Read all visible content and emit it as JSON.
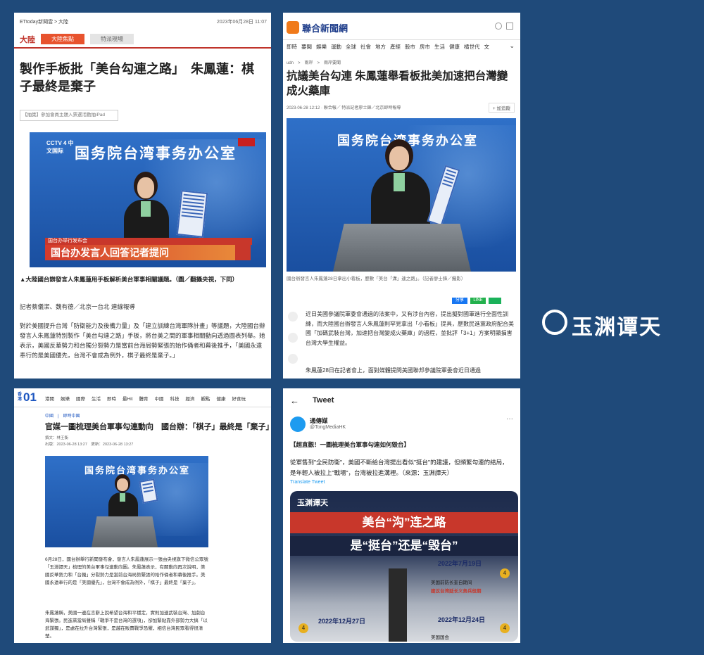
{
  "p1": {
    "source": "ETtoday新聞雲 > 大陸",
    "datetime": "2023年06月28日 11:07",
    "section": "大陸",
    "tab_active": "大陸焦點",
    "tab_other": "特派現場",
    "headline": "製作手板批「美台勾連之路」　朱鳳蓮：棋子最終是棄子",
    "promo": "【抽獎】參加會員主題入票選活動抽iPad",
    "tv_logo": "CCTV 4 中文国际",
    "sign": "国务院台湾事务办公室",
    "banner_top": "国台办举行发布会",
    "banner": "国台办发言人回答记者提问",
    "caption": "▲大陸國台辦發言人朱鳳蓮用手板解析美台軍事相關議題。（圖／翻攝央視，下同）",
    "byline": "記者蔡儀潔、魏有德／北京一台北 連線報導",
    "body": "對於美國提升台灣「防衛能力及後備力量」及「建立訓練台灣軍隊計畫」等議題，大陸國台辦發言人朱鳳蓮特別製作「美台勾連之路」手板，將台美之間的軍事相關動向透過圖表列舉。她表示，美國反華勢力和台獨分裂勢力是當前台海局勢緊張的始作俑者和幕後推手，「美國永遠奉行的是美國優先，台灣不會成為例外，棋子最終是棄子。」"
  },
  "p2": {
    "brand": "聯合新聞網",
    "nav": [
      "即時",
      "要聞",
      "娛樂",
      "運動",
      "全球",
      "社會",
      "地方",
      "產經",
      "股市",
      "房市",
      "生活",
      "健康",
      "橘世代",
      "文"
    ],
    "breadcrumb": "udn　>　兩岸　>　兩岸要聞",
    "headline": "抗議美台勾連 朱鳳蓮舉看板批美加速把台灣變成火藥庫",
    "meta": "2023-06-28 12:12 · 聯合報／ 特派記者廖士鋒／北京即時報導",
    "follow": "+ 加追蹤",
    "sign": "国务院台湾事务办公室",
    "caption": "國台辦發言人朱鳳蓮28日拿出小看板，歷數「美台「溝」連之路」。（記者廖士鋒／攝影）",
    "share1": "分享",
    "share2": "LINE",
    "body1": "近日美國參議院軍委會通過的法案中，又有涉台內容，提出擬對國軍進行全面性訓練，而大陸國台辦發言人朱鳳蓮則罕見拿出「小看板」提具，歷數民進黨政府配合美國「加碼武裝台灣，加速把台灣變成火藥庫」的過程，並批評「3+1」方案明顯損害台灣大學生權益。",
    "body2": "朱鳳蓮28日在記者會上，面對媒體提問美國聯邦參議院軍委會近日通過"
  },
  "p3": {
    "logo": "01",
    "logo_small": "香港",
    "nav": [
      "港聞",
      "娛樂",
      "國際",
      "生活",
      "即時",
      "最Hit",
      "體育",
      "中國",
      "科技",
      "經濟",
      "觀點",
      "健康",
      "好食玩"
    ],
    "breadcrumb": "中國　|　即時中國",
    "headline": "官媒一圖梳理美台軍事勾連動向　國台辦：「棋子」最終是「棄子」",
    "author": "撰文：林王衡",
    "published": "出版：2023-06-28 13:27　更新：2023-06-28 13:27",
    "sign": "国务院台湾事务办公室",
    "body1": "6月28日，國台辦舉行新聞發布會，發言人朱鳳蓮展示一張由央視旗下微信公眾號「玉淵譚天」梳理的美台軍事勾連動向圖。朱鳳蓮表示，有關動向再次說明，美國反華勢力和「台獨」分裂勢力是當前台海局勢緊張的始作俑者和幕後推手。美國永遠奉行的是「美國優先」，台灣不會成為例外，「棋子」最終是「棄子」。",
    "body2": "朱鳳蓮稱，美國一邊在言辭上說希望台海和平穩定，實則加速武裝台灣、加劇台海緊張。民進黨當局聲稱「戰爭不是台灣的選項」，卻加緊貼靠外部勢力大搞「以武謀獨」，是處在拉升台灣緊張，是越在販賣戰爭恐懼，相信台灣民眾看得很清楚。"
  },
  "p4": {
    "back": "←",
    "title": "Tweet",
    "user": "通傳媒",
    "handle": "@TongMediaHK",
    "more": "···",
    "text1": "【超直觀！一圖梳理美台軍事勾連如何毀台】",
    "text2": "從軍售到\"全民防衛\"，美國不斷給台灣提出看似\"挺台\"的建議，但頻繁勾連的結局，是年輕人被拉上\"戰場\"，台灣被拉進溝裡。（來源：玉淵譚天）",
    "translate": "Translate Tweet",
    "img_logo": "玉渊谭天",
    "img_line1": "美台“沟”连之路",
    "img_line2": "是“挺台”还是“毁台”",
    "date1": "2022年7月19日",
    "desc1a": "美国前防长奎自期间",
    "desc1b": "建议台湾延长义务兵役期",
    "date2": "2022年12月27日",
    "date3": "2022年12月24日",
    "desc3": "美国国会",
    "num": "4"
  },
  "watermark": "玉渊谭天"
}
